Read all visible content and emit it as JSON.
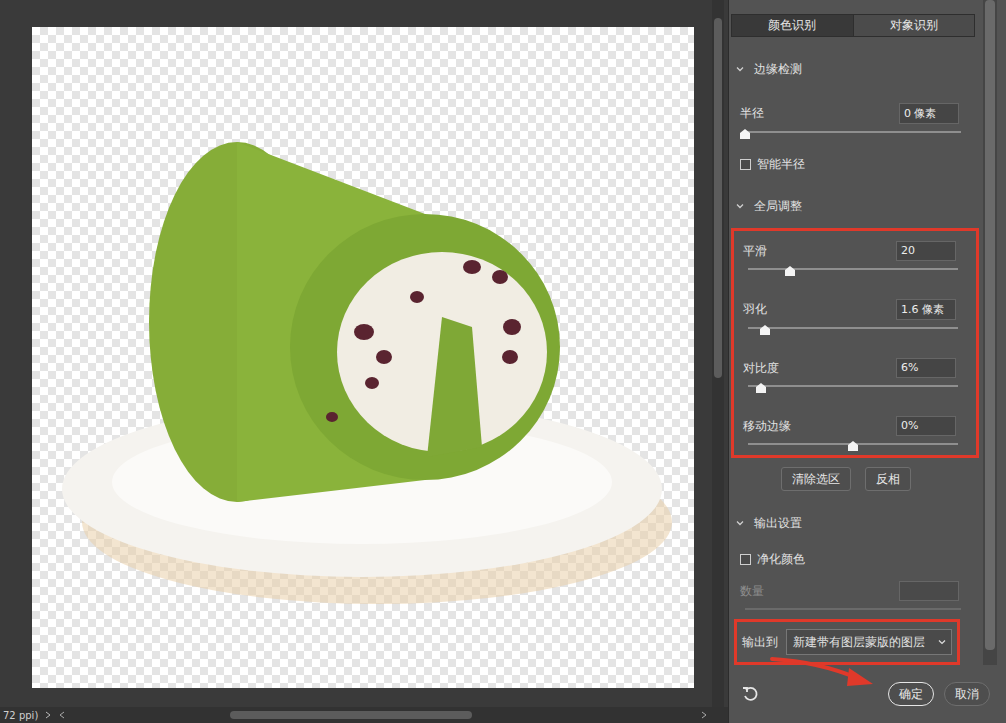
{
  "canvas": {
    "status": "72 ppi)"
  },
  "panel": {
    "tabs": [
      {
        "label": "颜色识别",
        "selected": true
      },
      {
        "label": "对象识别",
        "selected": false
      }
    ],
    "sections": [
      {
        "title": "边缘检测",
        "expanded": true,
        "highlighted": false,
        "rows": [
          {
            "kind": "slider",
            "label": "半径",
            "value": "0 像素",
            "level": 0,
            "disabled": false
          },
          {
            "kind": "checkbox",
            "label": "智能半径",
            "checked": false
          }
        ],
        "actions": []
      },
      {
        "title": "全局调整",
        "expanded": true,
        "highlighted": true,
        "rows": [
          {
            "kind": "slider",
            "label": "平滑",
            "value": "20",
            "level": 0.2,
            "disabled": false
          },
          {
            "kind": "slider",
            "label": "羽化",
            "value": "1.6 像素",
            "level": 0.08,
            "disabled": false
          },
          {
            "kind": "slider",
            "label": "对比度",
            "value": "6%",
            "level": 0.06,
            "disabled": false
          },
          {
            "kind": "slider",
            "label": "移动边缘",
            "value": "0%",
            "level": 0.5,
            "disabled": false
          }
        ],
        "actions": [
          "清除选区",
          "反相"
        ]
      },
      {
        "title": "输出设置",
        "expanded": true,
        "highlighted": false,
        "rows": [
          {
            "kind": "checkbox",
            "label": "净化颜色",
            "checked": false
          },
          {
            "kind": "slider",
            "label": "数量",
            "value": "",
            "disabled": true
          },
          {
            "kind": "select",
            "label": "输出到",
            "value": "新建带有图层蒙版的图层",
            "highlighted": true
          }
        ],
        "actions": []
      }
    ],
    "footer": {
      "buttons": [
        {
          "label": "确定",
          "default": true,
          "pointed": true
        },
        {
          "label": "取消",
          "default": false,
          "pointed": false
        }
      ]
    }
  }
}
